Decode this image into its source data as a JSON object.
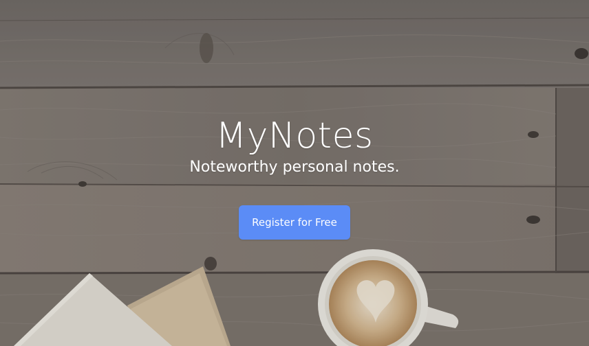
{
  "hero": {
    "title": "MyNotes",
    "subtitle": "Noteworthy personal notes.",
    "register_label": "Register for Free"
  },
  "colors": {
    "button_bg": "#5b8cf6",
    "wood": "#7a7470",
    "text": "#ffffff"
  },
  "background": {
    "scene": "wood-table-with-latte-and-notebooks"
  }
}
